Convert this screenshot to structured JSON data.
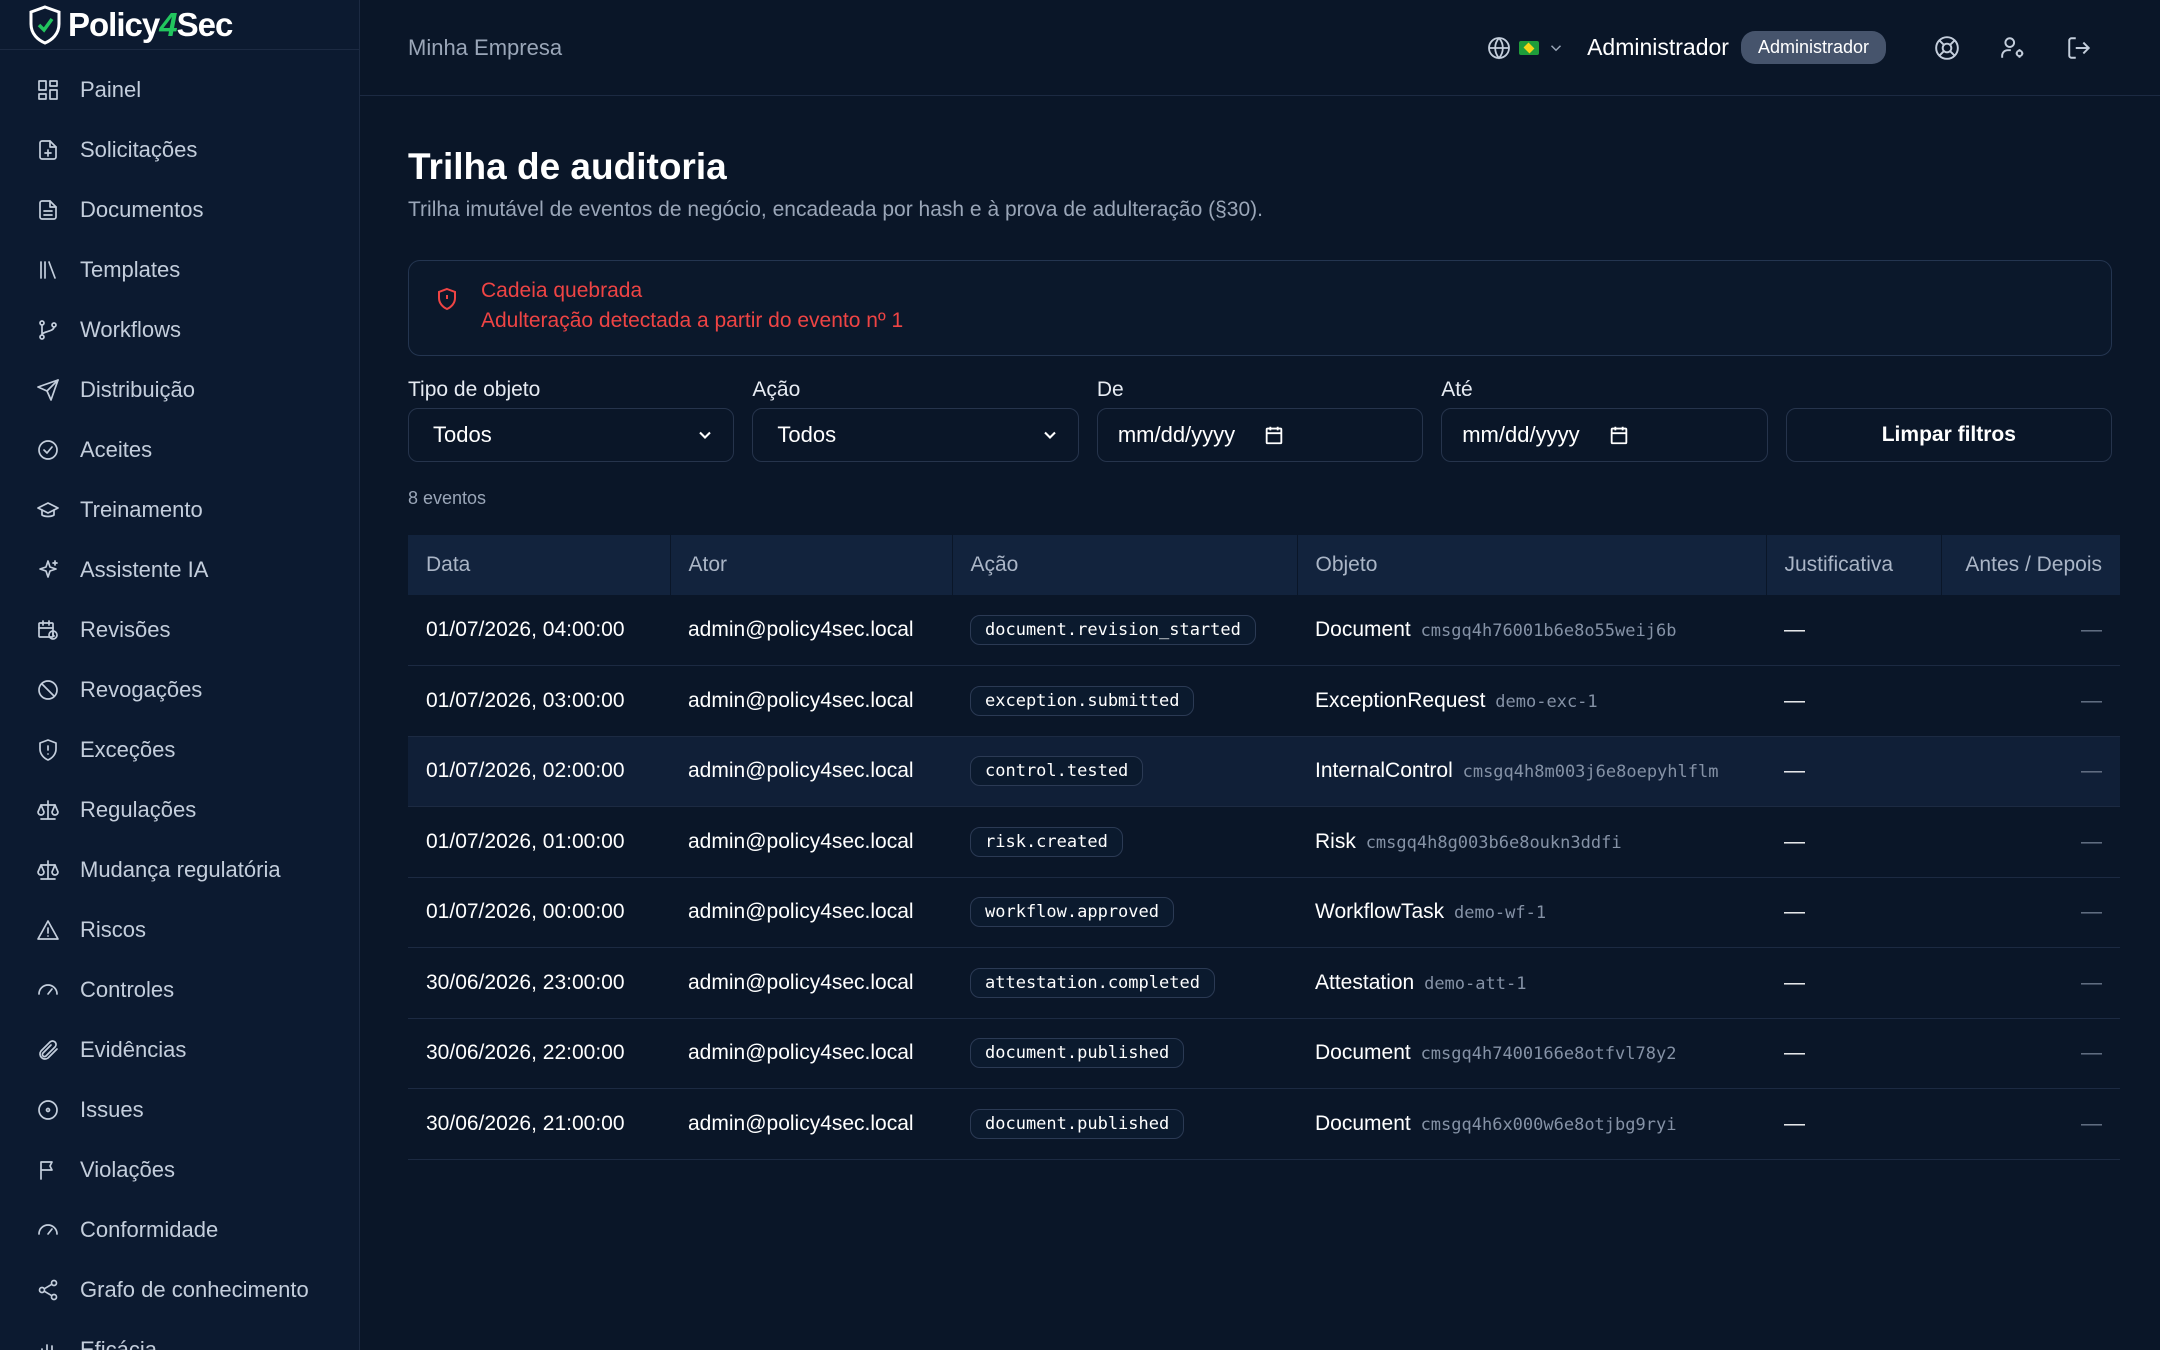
{
  "brand": {
    "name_left": "Policy",
    "name_four": "4",
    "name_right": "Sec"
  },
  "sidebar": {
    "items": [
      {
        "label": "Painel",
        "icon": "dashboard-icon"
      },
      {
        "label": "Solicitações",
        "icon": "file-plus-icon"
      },
      {
        "label": "Documentos",
        "icon": "document-icon"
      },
      {
        "label": "Templates",
        "icon": "library-icon"
      },
      {
        "label": "Workflows",
        "icon": "git-branch-icon"
      },
      {
        "label": "Distribuição",
        "icon": "send-icon"
      },
      {
        "label": "Aceites",
        "icon": "check-circle-icon"
      },
      {
        "label": "Treinamento",
        "icon": "graduation-cap-icon"
      },
      {
        "label": "Assistente IA",
        "icon": "sparkles-icon"
      },
      {
        "label": "Revisões",
        "icon": "calendar-clock-icon"
      },
      {
        "label": "Revogações",
        "icon": "ban-icon"
      },
      {
        "label": "Exceções",
        "icon": "shield-alert-icon"
      },
      {
        "label": "Regulações",
        "icon": "scale-icon"
      },
      {
        "label": "Mudança regulatória",
        "icon": "scale-icon"
      },
      {
        "label": "Riscos",
        "icon": "alert-triangle-icon"
      },
      {
        "label": "Controles",
        "icon": "gauge-icon"
      },
      {
        "label": "Evidências",
        "icon": "paperclip-icon"
      },
      {
        "label": "Issues",
        "icon": "circle-dot-icon"
      },
      {
        "label": "Violações",
        "icon": "flag-icon"
      },
      {
        "label": "Conformidade",
        "icon": "gauge-icon"
      },
      {
        "label": "Grafo de conhecimento",
        "icon": "share-icon"
      },
      {
        "label": "Eficácia",
        "icon": "chart-icon"
      }
    ]
  },
  "header": {
    "org_name": "Minha Empresa",
    "user_name": "Administrador",
    "role_badge": "Administrador"
  },
  "page": {
    "title": "Trilha de auditoria",
    "subtitle": "Trilha imutável de eventos de negócio, encadeada por hash e à prova de adulteração (§30)."
  },
  "alert": {
    "title": "Cadeia quebrada",
    "message": "Adulteração detectada a partir do evento nº 1"
  },
  "filters": {
    "object_type_label": "Tipo de objeto",
    "object_type_value": "Todos",
    "action_label": "Ação",
    "action_value": "Todos",
    "from_label": "De",
    "from_placeholder": "mm/dd/yyyy",
    "to_label": "Até",
    "to_placeholder": "mm/dd/yyyy",
    "clear_label": "Limpar filtros"
  },
  "count_label": "8 eventos",
  "table": {
    "headers": [
      "Data",
      "Ator",
      "Ação",
      "Objeto",
      "Justificativa",
      "Antes / Depois"
    ],
    "rows": [
      {
        "date": "01/07/2026, 04:00:00",
        "actor": "admin@policy4sec.local",
        "action": "document.revision_started",
        "object_type": "Document",
        "object_id": "cmsgq4h76001b6e8o55weij6b",
        "justification": "—",
        "diff": "—"
      },
      {
        "date": "01/07/2026, 03:00:00",
        "actor": "admin@policy4sec.local",
        "action": "exception.submitted",
        "object_type": "ExceptionRequest",
        "object_id": "demo-exc-1",
        "justification": "—",
        "diff": "—"
      },
      {
        "date": "01/07/2026, 02:00:00",
        "actor": "admin@policy4sec.local",
        "action": "control.tested",
        "object_type": "InternalControl",
        "object_id": "cmsgq4h8m003j6e8oepyhlflm",
        "justification": "—",
        "diff": "—"
      },
      {
        "date": "01/07/2026, 01:00:00",
        "actor": "admin@policy4sec.local",
        "action": "risk.created",
        "object_type": "Risk",
        "object_id": "cmsgq4h8g003b6e8oukn3ddfi",
        "justification": "—",
        "diff": "—"
      },
      {
        "date": "01/07/2026, 00:00:00",
        "actor": "admin@policy4sec.local",
        "action": "workflow.approved",
        "object_type": "WorkflowTask",
        "object_id": "demo-wf-1",
        "justification": "—",
        "diff": "—"
      },
      {
        "date": "30/06/2026, 23:00:00",
        "actor": "admin@policy4sec.local",
        "action": "attestation.completed",
        "object_type": "Attestation",
        "object_id": "demo-att-1",
        "justification": "—",
        "diff": "—"
      },
      {
        "date": "30/06/2026, 22:00:00",
        "actor": "admin@policy4sec.local",
        "action": "document.published",
        "object_type": "Document",
        "object_id": "cmsgq4h7400166e8otfvl78y2",
        "justification": "—",
        "diff": "—"
      },
      {
        "date": "30/06/2026, 21:00:00",
        "actor": "admin@policy4sec.local",
        "action": "document.published",
        "object_type": "Document",
        "object_id": "cmsgq4h6x000w6e8otjbg9ryi",
        "justification": "—",
        "diff": "—"
      }
    ]
  },
  "colors": {
    "background": "#0a1628",
    "sidebar": "#0c1a30",
    "alert_red": "#ef4444",
    "brand_green": "#22c55e",
    "badge": "#46546c"
  }
}
